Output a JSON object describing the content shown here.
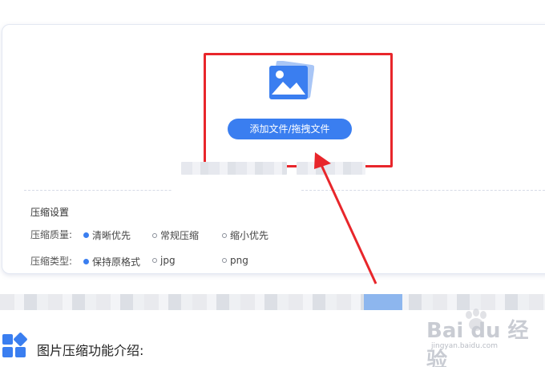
{
  "upload": {
    "button_label": "添加文件/拖拽文件"
  },
  "settings": {
    "title": "压缩设置",
    "quality": {
      "label": "压缩质量:",
      "options": [
        {
          "label": "清晰优先",
          "selected": true
        },
        {
          "label": "常规压缩",
          "selected": false
        },
        {
          "label": "缩小优先",
          "selected": false
        }
      ]
    },
    "type": {
      "label": "压缩类型:",
      "options": [
        {
          "label": "保持原格式",
          "selected": true
        },
        {
          "label": "jpg",
          "selected": false
        },
        {
          "label": "png",
          "selected": false
        }
      ]
    }
  },
  "section": {
    "title": "图片压缩功能介绍:"
  },
  "watermark": {
    "brand": "Bai du 经验",
    "url": "jingyan.baidu.com"
  },
  "colors": {
    "accent": "#3a7ef0",
    "highlight": "#e8262b"
  },
  "icons": {
    "upload": "image-icon",
    "section": "apps-grid-icon"
  }
}
